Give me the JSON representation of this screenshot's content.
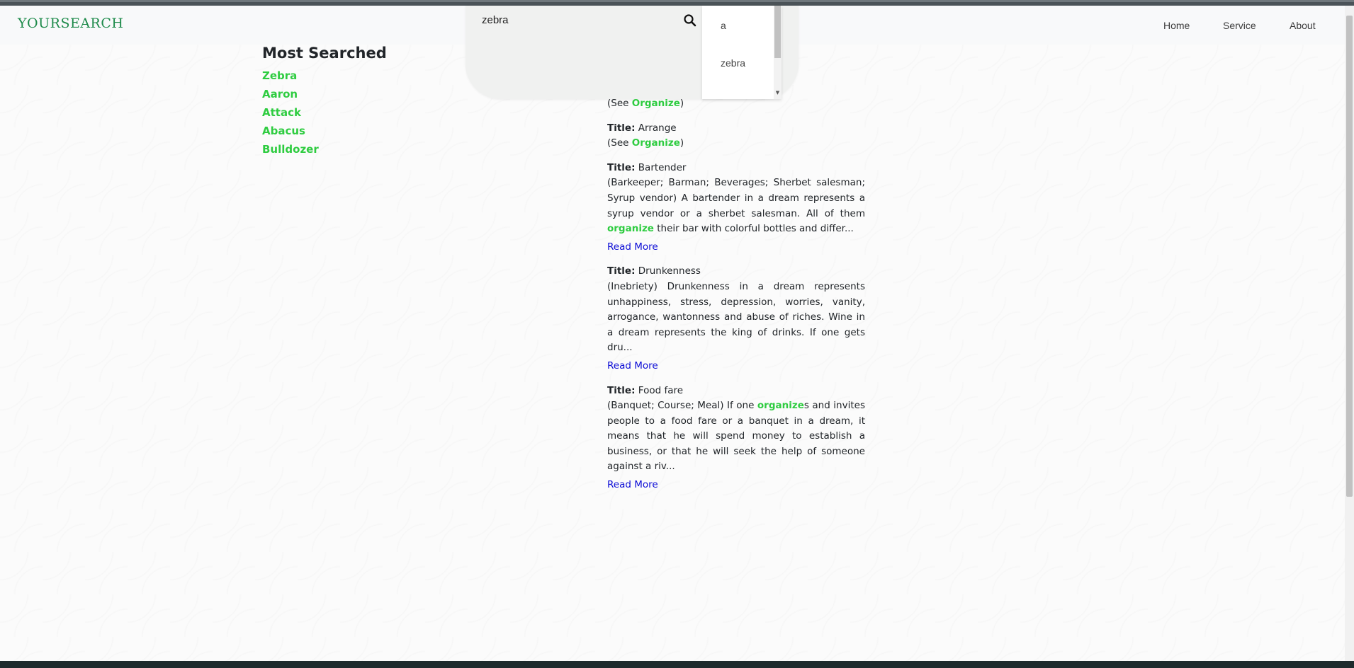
{
  "brand": "YOURSEARCH",
  "nav": {
    "home": "Home",
    "service": "Service",
    "about": "About"
  },
  "search": {
    "value": "zebra",
    "suggestions": [
      "a",
      "zebra"
    ]
  },
  "most_searched": {
    "title": "Most Searched",
    "items": [
      "Zebra",
      "Aaron",
      "Attack",
      "Abacus",
      "Bulldozer"
    ]
  },
  "results": {
    "title_label": "Title:",
    "read_more": "Read More",
    "entries": [
      {
        "see_prefix": "(See ",
        "see_link": "Organize",
        "see_suffix": ")"
      },
      {
        "title": "Arrange",
        "see_prefix": "(See ",
        "see_link": "Organize",
        "see_suffix": ")"
      },
      {
        "title": "Bartender",
        "text_before": "(Barkeeper; Barman; Beverages; Sherbet salesman; Syrup vendor) A bartender in a dream represents a syrup vendor or a sherbet salesman. All of them ",
        "highlight": "organize",
        "text_after": " their bar with colorful bottles and differ..."
      },
      {
        "title": "Drunkenness",
        "text_before": "(Inebriety) Drunkenness in a dream represents unhappiness, stress, depression, worries, vanity, arrogance, wantonness and abuse of riches. Wine in a dream represents the king of drinks. If one gets dru..."
      },
      {
        "title": "Food fare",
        "text_before": "(Banquet; Course; Meal) If one ",
        "highlight": "organize",
        "text_after": "s and invites people to a food fare or a banquet in a dream, it means that he will spend money to establish a business, or that he will seek the help of someone against a riv..."
      }
    ]
  },
  "colors": {
    "brand": "#1d8a4a",
    "highlight": "#2ecc40",
    "link": "#0d0dd6"
  }
}
